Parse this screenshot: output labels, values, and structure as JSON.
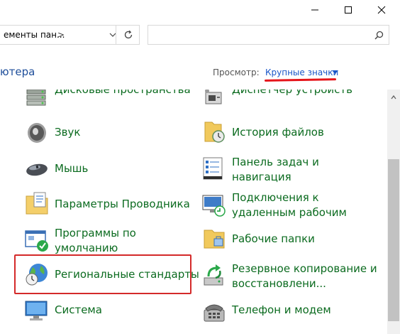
{
  "window": {
    "minimize_icon": "minimize-icon",
    "maximize_icon": "maximize-icon",
    "close_icon": "close-icon"
  },
  "address": {
    "path_text": "ементы пан...",
    "separator": ">",
    "search_placeholder": ""
  },
  "header": {
    "title_fragment": "ютера",
    "view_label": "Просмотр:",
    "view_value": "Крупные значки"
  },
  "items": {
    "left": [
      {
        "label": "Дисковые пространства",
        "icon": "storage-spaces-icon"
      },
      {
        "label": "Звук",
        "icon": "speaker-icon"
      },
      {
        "label": "Мышь",
        "icon": "mouse-icon"
      },
      {
        "label": "Параметры Проводника",
        "icon": "folder-options-icon"
      },
      {
        "label_l1": "Программы по",
        "label_l2": "умолчанию",
        "icon": "default-programs-icon"
      },
      {
        "label": "Региональные стандарты",
        "icon": "region-globe-icon"
      },
      {
        "label": "Система",
        "icon": "system-monitor-icon"
      }
    ],
    "right": [
      {
        "label": "Диспетчер устройств",
        "icon": "device-manager-icon"
      },
      {
        "label": "История файлов",
        "icon": "file-history-icon"
      },
      {
        "label_l1": "Панель задач и",
        "label_l2": "навигация",
        "icon": "taskbar-icon"
      },
      {
        "label_l1": "Подключения к",
        "label_l2": "удаленным рабочим",
        "icon": "remote-desktop-icon"
      },
      {
        "label": "Рабочие папки",
        "icon": "work-folders-icon"
      },
      {
        "label_l1": "Резервное копирование и",
        "label_l2": "восстановлени...",
        "icon": "backup-restore-icon"
      },
      {
        "label": "Телефон и модем",
        "icon": "phone-modem-icon"
      }
    ]
  },
  "colors": {
    "link_green": "#0b6b1f",
    "title_blue": "#1e4e9a",
    "view_blue": "#1a56c8",
    "annotation_red": "#e5141a"
  }
}
